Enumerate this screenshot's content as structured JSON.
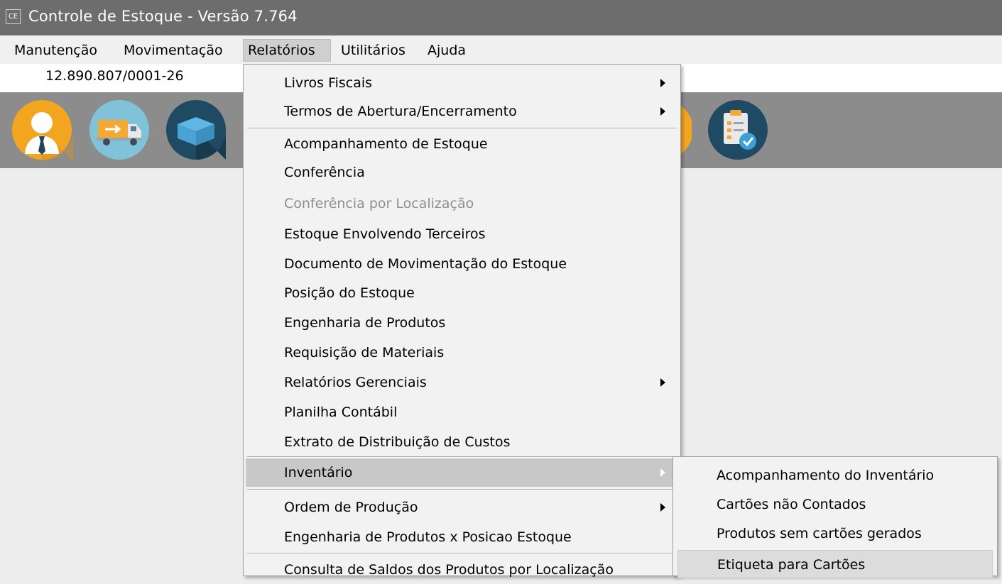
{
  "window": {
    "app_icon": "CE",
    "title": "Controle de Estoque - Versão 7.764"
  },
  "menubar": {
    "items": [
      {
        "label": "Manutenção"
      },
      {
        "label": "Movimentação"
      },
      {
        "label": "Relatórios"
      },
      {
        "label": "Utilitários"
      },
      {
        "label": "Ajuda"
      }
    ]
  },
  "info": {
    "cnpj": "12.890.807/0001-26"
  },
  "toolbar": {
    "icons": [
      "user-businessman-icon",
      "delivery-truck-icon",
      "box-icon",
      "orange-circle-icon",
      "clipboard-check-icon"
    ]
  },
  "relatorios_menu": {
    "items": [
      {
        "label": "Livros Fiscais"
      },
      {
        "label": "Termos de Abertura/Encerramento"
      },
      {
        "label": "Acompanhamento de Estoque"
      },
      {
        "label": "Conferência"
      },
      {
        "label": "Conferência por Localização"
      },
      {
        "label": "Estoque Envolvendo Terceiros"
      },
      {
        "label": "Documento de Movimentação do Estoque"
      },
      {
        "label": "Posição do Estoque"
      },
      {
        "label": "Engenharia de Produtos"
      },
      {
        "label": "Requisição de Materiais"
      },
      {
        "label": "Relatórios Gerenciais"
      },
      {
        "label": "Planilha Contábil"
      },
      {
        "label": "Extrato de Distribuição de Custos"
      },
      {
        "label": "Inventário"
      },
      {
        "label": "Ordem de Produção"
      },
      {
        "label": "Engenharia de Produtos x Posicao Estoque"
      },
      {
        "label": "Consulta de Saldos dos Produtos por Localização"
      }
    ]
  },
  "inventario_submenu": {
    "items": [
      {
        "label": "Acompanhamento do Inventário"
      },
      {
        "label": "Cartões não Contados"
      },
      {
        "label": "Produtos sem cartões gerados"
      },
      {
        "label": "Etiqueta para Cartões"
      }
    ]
  },
  "colors": {
    "titlebar": "#6d6d6d",
    "toolbar": "#8c8c8c",
    "menu_bg": "#f2f2f2",
    "highlight": "#c8c8c8"
  }
}
